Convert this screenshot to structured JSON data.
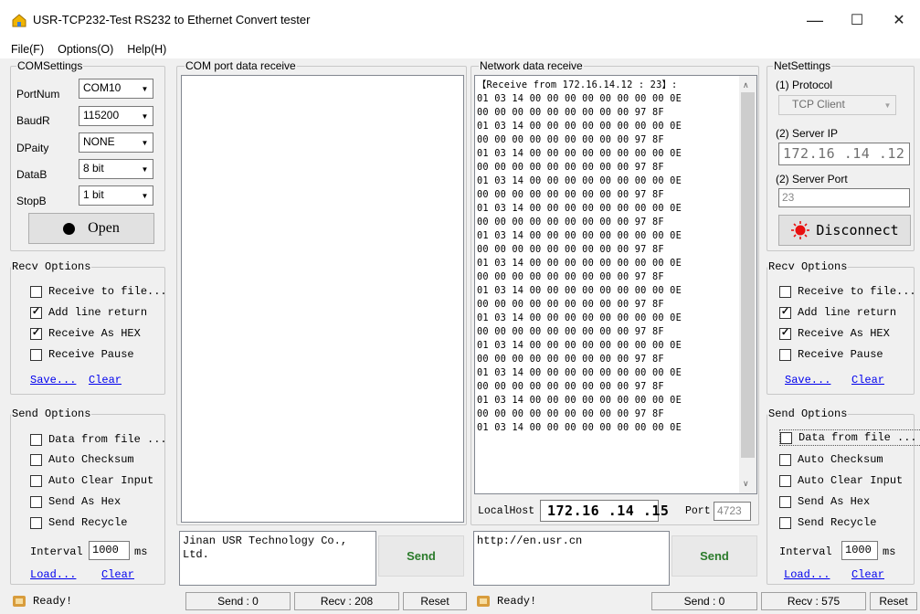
{
  "window": {
    "title": "USR-TCP232-Test  RS232 to Ethernet Convert tester",
    "minimize": "—",
    "maximize": "☐",
    "close": "✕"
  },
  "menu": [
    "File(F)",
    "Options(O)",
    "Help(H)"
  ],
  "com_settings": {
    "title": "COMSettings",
    "fields": [
      {
        "label": "PortNum",
        "value": "COM10"
      },
      {
        "label": "BaudR",
        "value": "115200"
      },
      {
        "label": "DPaity",
        "value": "NONE"
      },
      {
        "label": "DataB",
        "value": "8 bit"
      },
      {
        "label": "StopB",
        "value": "1 bit"
      }
    ],
    "open_button": "Open"
  },
  "left_recv": {
    "title": "Recv Options",
    "options": [
      {
        "label": "Receive to file...",
        "checked": false
      },
      {
        "label": "Add line return",
        "checked": true
      },
      {
        "label": "Receive As HEX",
        "checked": true
      },
      {
        "label": "Receive Pause",
        "checked": false
      }
    ],
    "save": "Save...",
    "clear": "Clear"
  },
  "left_send": {
    "title": "Send Options",
    "options": [
      {
        "label": "Data from file ...",
        "checked": false
      },
      {
        "label": "Auto Checksum",
        "checked": false
      },
      {
        "label": "Auto Clear Input",
        "checked": false
      },
      {
        "label": "Send As Hex",
        "checked": false
      },
      {
        "label": "Send Recycle",
        "checked": false
      }
    ],
    "interval_label": "Interval",
    "interval_value": "1000",
    "interval_unit": "ms",
    "load": "Load...",
    "clear": "Clear"
  },
  "com_receive": {
    "title": "COM port data receive",
    "send_text": "Jinan USR Technology Co., Ltd.",
    "send_button": "Send"
  },
  "net_receive": {
    "title": "Network data receive",
    "lines": [
      "【Receive from 172.16.14.12 : 23】:",
      "01 03 14 00 00 00 00 00 00 00 00 0E",
      "00 00 00 00 00 00 00 00 00 97 8F",
      "01 03 14 00 00 00 00 00 00 00 00 0E",
      "00 00 00 00 00 00 00 00 00 97 8F",
      "01 03 14 00 00 00 00 00 00 00 00 0E",
      "00 00 00 00 00 00 00 00 00 97 8F",
      "01 03 14 00 00 00 00 00 00 00 00 0E",
      "00 00 00 00 00 00 00 00 00 97 8F",
      "01 03 14 00 00 00 00 00 00 00 00 0E",
      "00 00 00 00 00 00 00 00 00 97 8F",
      "01 03 14 00 00 00 00 00 00 00 00 0E",
      "00 00 00 00 00 00 00 00 00 97 8F",
      "01 03 14 00 00 00 00 00 00 00 00 0E",
      "00 00 00 00 00 00 00 00 00 97 8F",
      "01 03 14 00 00 00 00 00 00 00 00 0E",
      "00 00 00 00 00 00 00 00 00 97 8F",
      "01 03 14 00 00 00 00 00 00 00 00 0E",
      "00 00 00 00 00 00 00 00 00 97 8F",
      "01 03 14 00 00 00 00 00 00 00 00 0E",
      "00 00 00 00 00 00 00 00 00 97 8F",
      "01 03 14 00 00 00 00 00 00 00 00 0E",
      "00 00 00 00 00 00 00 00 00 97 8F",
      "01 03 14 00 00 00 00 00 00 00 00 0E",
      "00 00 00 00 00 00 00 00 00 97 8F",
      "01 03 14 00 00 00 00 00 00 00 00 0E"
    ],
    "localhost_label": "LocalHost",
    "localhost_value": "172.16 .14 .15",
    "port_label": "Port",
    "port_value": "4723",
    "send_text": "http://en.usr.cn",
    "send_button": "Send"
  },
  "net_settings": {
    "title": "NetSettings",
    "protocol_label": "(1) Protocol",
    "protocol_value": "TCP Client",
    "server_ip_label": "(2) Server IP",
    "server_ip_value": "172.16 .14 .12",
    "server_port_label": "(2) Server Port",
    "server_port_value": "23",
    "disconnect_button": "Disconnect"
  },
  "right_recv": {
    "title": "Recv Options",
    "options": [
      {
        "label": "Receive to file...",
        "checked": false
      },
      {
        "label": "Add line return",
        "checked": true
      },
      {
        "label": "Receive As HEX",
        "checked": true
      },
      {
        "label": "Receive Pause",
        "checked": false
      }
    ],
    "save": "Save...",
    "clear": "Clear"
  },
  "right_send": {
    "title": "Send Options",
    "options": [
      {
        "label": "Data from file ...",
        "checked": false
      },
      {
        "label": "Auto Checksum",
        "checked": false
      },
      {
        "label": "Auto Clear Input",
        "checked": false
      },
      {
        "label": "Send As Hex",
        "checked": false
      },
      {
        "label": "Send Recycle",
        "checked": false
      }
    ],
    "interval_label": "Interval",
    "interval_value": "1000",
    "interval_unit": "ms",
    "load": "Load...",
    "clear": "Clear"
  },
  "status": {
    "left_ready": "Ready!",
    "left_send": "Send : 0",
    "left_recv": "Recv : 208",
    "left_reset": "Reset",
    "right_ready": "Ready!",
    "right_send": "Send : 0",
    "right_recv": "Recv : 575",
    "right_reset": "Reset"
  },
  "colors": {
    "link": "#0000ee",
    "disconnect_led": "#e81010"
  }
}
